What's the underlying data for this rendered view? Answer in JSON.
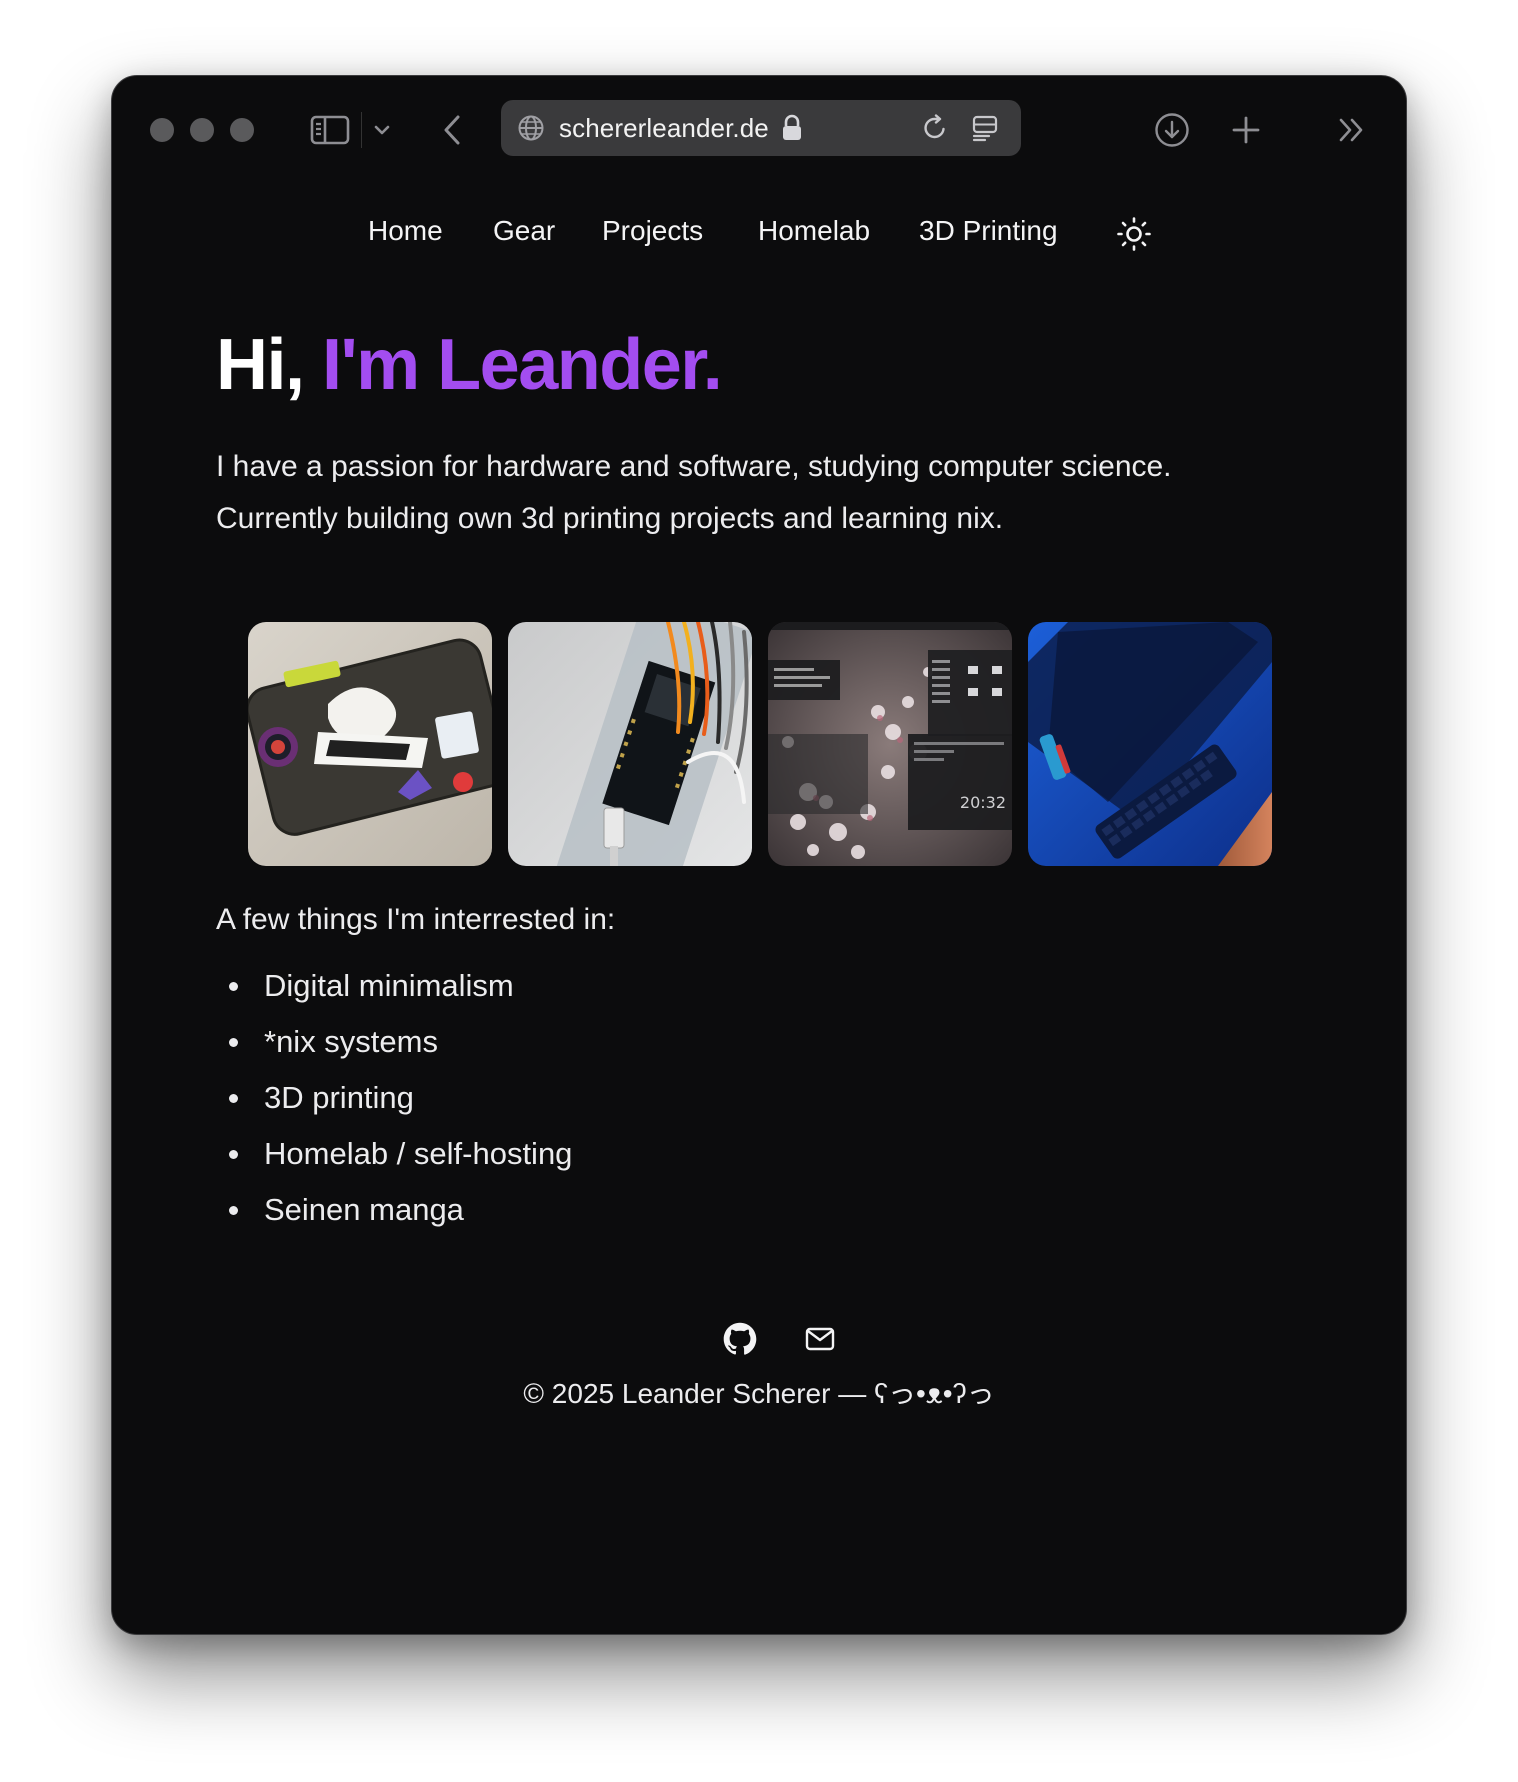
{
  "browser": {
    "url": "schererleander.de",
    "icons": [
      "sidebar-icon",
      "chevron-down-icon",
      "back-icon",
      "globe-icon",
      "lock-icon",
      "reload-icon",
      "reader-icon",
      "download-icon",
      "new-tab-icon",
      "overflow-icon"
    ]
  },
  "nav": {
    "items": [
      {
        "label": "Home"
      },
      {
        "label": "Gear"
      },
      {
        "label": "Projects"
      },
      {
        "label": "Homelab"
      },
      {
        "label": "3D Printing"
      }
    ],
    "theme_icon": "sun-icon"
  },
  "hero": {
    "greeting": "Hi,",
    "name": "I'm Leander.",
    "accent_color": "#a34df0",
    "intro_line1": "I have a passion for hardware and software, studying computer science.",
    "intro_line2": "Currently building own 3d printing projects and learning nix."
  },
  "gallery": {
    "images": [
      {
        "subject": "stickered handheld console"
      },
      {
        "subject": "microcontroller on breadboard with wires"
      },
      {
        "subject": "desktop screenshot with flowers",
        "clock": "20:32"
      },
      {
        "subject": "blue desk setup with keyboard"
      }
    ]
  },
  "interests": {
    "heading": "A few things I'm interrested in:",
    "items": [
      "Digital minimalism",
      "*nix systems",
      "3D printing",
      "Homelab / self-hosting",
      "Seinen manga"
    ]
  },
  "footer": {
    "icons": [
      "github-icon",
      "mail-icon"
    ],
    "copyright": "© 2025 Leander Scherer — ʕっ•ᴥ•ʔっ"
  }
}
